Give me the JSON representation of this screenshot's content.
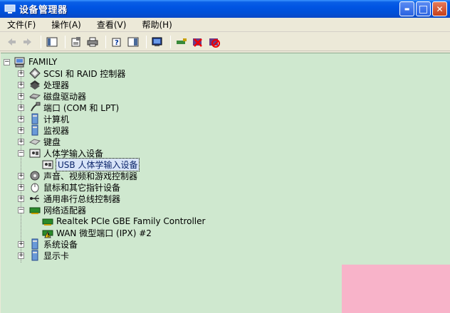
{
  "window": {
    "title": "设备管理器",
    "minimize": "▬",
    "maximize": "□",
    "close": "✕"
  },
  "menu": [
    {
      "label": "文件(F)"
    },
    {
      "label": "操作(A)"
    },
    {
      "label": "查看(V)"
    },
    {
      "label": "帮助(H)"
    }
  ],
  "toolbar": [
    "back-icon",
    "forward-icon",
    "console-tree-icon",
    "properties-icon",
    "print-icon",
    "help-icon",
    "show-hide-icon",
    "scan-hardware-icon",
    "update-driver-icon",
    "disable-device-icon",
    "uninstall-device-icon"
  ],
  "tree": {
    "root": "FAMILY",
    "items": [
      {
        "label": "SCSI 和 RAID 控制器",
        "expanded": false
      },
      {
        "label": "处理器",
        "expanded": false
      },
      {
        "label": "磁盘驱动器",
        "expanded": false
      },
      {
        "label": "端口 (COM 和 LPT)",
        "expanded": false
      },
      {
        "label": "计算机",
        "expanded": false
      },
      {
        "label": "监视器",
        "expanded": false
      },
      {
        "label": "键盘",
        "expanded": false
      },
      {
        "label": "人体学输入设备",
        "expanded": true
      },
      {
        "label": "USB 人体学输入设备",
        "child": true,
        "selected": true
      },
      {
        "label": "声音、视频和游戏控制器",
        "expanded": false
      },
      {
        "label": "鼠标和其它指针设备",
        "expanded": false
      },
      {
        "label": "通用串行总线控制器",
        "expanded": false
      },
      {
        "label": "网络适配器",
        "expanded": true
      },
      {
        "label": "Realtek PCIe GBE Family Controller",
        "child": true
      },
      {
        "label": "WAN 微型端口 (IPX) #2",
        "child": true
      },
      {
        "label": "系统设备",
        "expanded": false
      },
      {
        "label": "显示卡",
        "expanded": false
      }
    ]
  }
}
